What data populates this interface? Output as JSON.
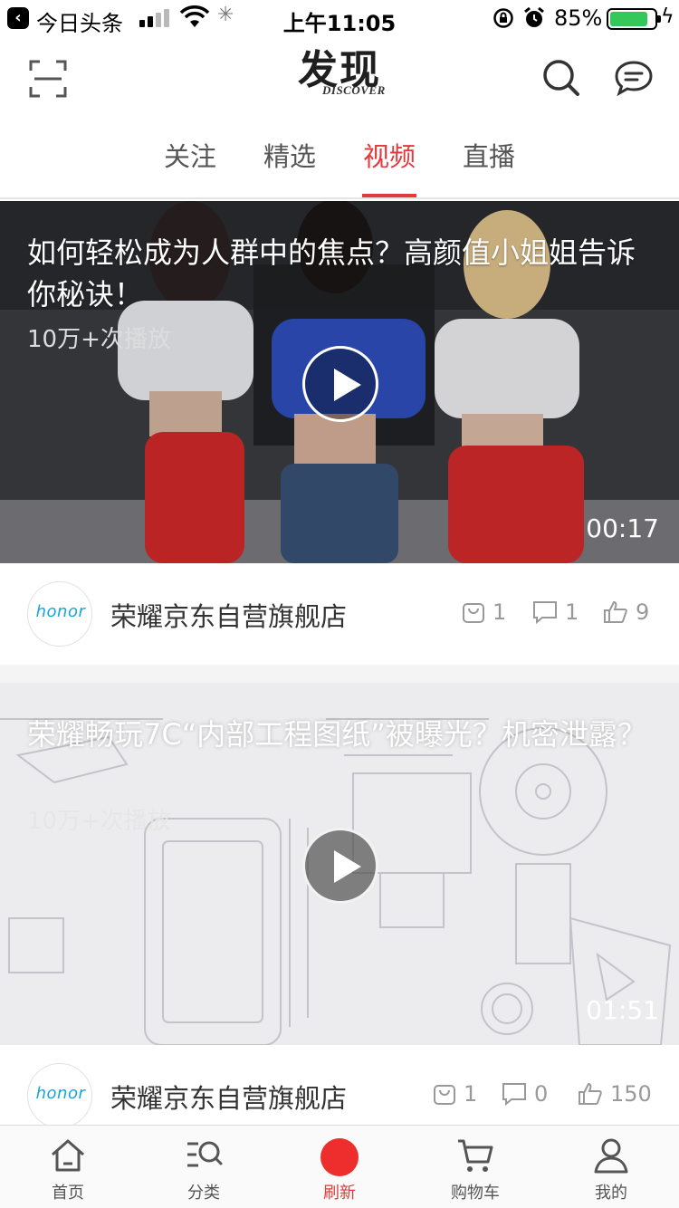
{
  "status_bar": {
    "back_app": "今日头条",
    "time": "上午11:05",
    "battery_percent": "85%",
    "battery_level": 0.85
  },
  "nav": {
    "logo_main": "发现",
    "logo_sub": "DISCOVER"
  },
  "tabs": [
    {
      "label": "关注",
      "active": false
    },
    {
      "label": "精选",
      "active": false
    },
    {
      "label": "视频",
      "active": true
    },
    {
      "label": "直播",
      "active": false
    }
  ],
  "videos": [
    {
      "title": "如何轻松成为人群中的焦点？高颜值小姐姐告诉你秘诀！",
      "plays": "10万+次播放",
      "duration": "00:17",
      "shop": "荣耀京东自营旗舰店",
      "shop_logo_text": "honor",
      "shop_count": "1",
      "comments": "1",
      "likes": "9"
    },
    {
      "title": "荣耀畅玩7C“内部工程图纸”被曝光？机密泄露？",
      "plays": "10万+次播放",
      "duration": "01:51",
      "shop": "荣耀京东自营旗舰店",
      "shop_logo_text": "honor",
      "shop_count": "1",
      "comments": "0",
      "likes": "150"
    }
  ],
  "tab_bar": [
    {
      "label": "首页",
      "icon": "home-icon"
    },
    {
      "label": "分类",
      "icon": "category-search-icon"
    },
    {
      "label": "刷新",
      "icon": "refresh-dot-icon",
      "active": true
    },
    {
      "label": "购物车",
      "icon": "cart-icon"
    },
    {
      "label": "我的",
      "icon": "profile-icon"
    }
  ],
  "colors": {
    "accent": "#e4393c",
    "battery": "#34c759",
    "honor_blue": "#1aa3d9"
  }
}
